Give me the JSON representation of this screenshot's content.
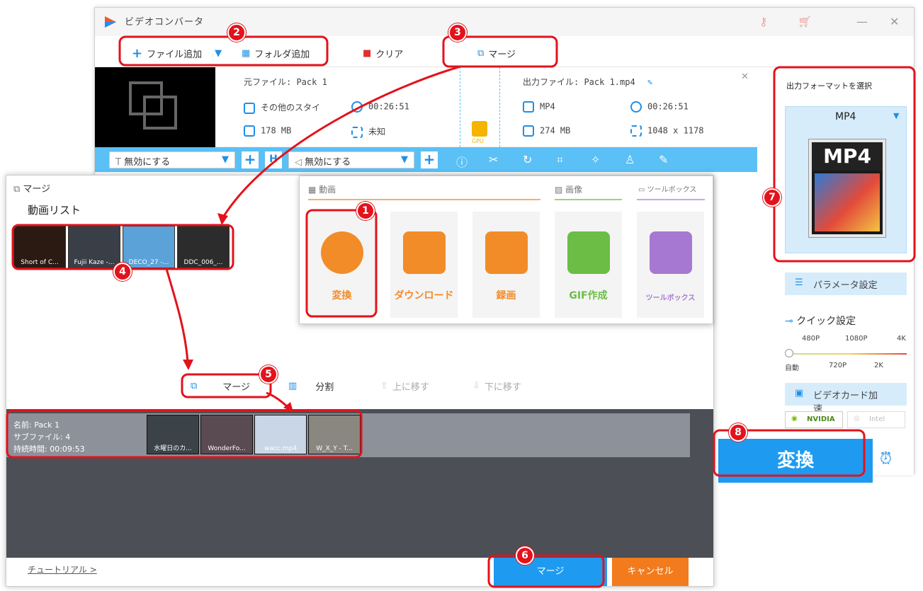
{
  "app": {
    "title": "ビデオコンバータ"
  },
  "toolbar": {
    "add_file": "ファイル追加",
    "add_folder": "フォルダ追加",
    "clear": "クリア",
    "merge": "マージ"
  },
  "file_item": {
    "source_label": "元ファイル: Pack 1",
    "source_format": "その他のスタイ",
    "source_duration": "00:26:51",
    "source_size": "178 MB",
    "source_resolution": "未知",
    "gpu": "GPU",
    "output_label": "出力ファイル: Pack 1.mp4",
    "output_format": "MP4",
    "output_duration": "00:26:51",
    "output_size": "274 MB",
    "output_resolution": "1048 x 1178"
  },
  "editbar": {
    "subtitle_select": "無効にする",
    "audio_select": "無効にする"
  },
  "right_panel": {
    "format_title": "出力フォーマットを選択",
    "format_value": "MP4",
    "format_icon_text": "MP4",
    "param_button": "パラメータ設定",
    "quick_title": "クイック設定",
    "quality_top": [
      "480P",
      "1080P",
      "4K"
    ],
    "quality_bottom": [
      "自動",
      "720P",
      "2K"
    ],
    "gpu_button": "ビデオカード加速",
    "nvidia": "NVIDIA",
    "intel": "Intel",
    "convert_button": "変換"
  },
  "merge_dialog": {
    "title": "マージ",
    "video_list_label": "動画リスト",
    "videos": [
      "Short of C...",
      "Fujii Kaze -...",
      "DECO_27 -...",
      "DDC_006_..."
    ],
    "merge_btn": "マージ",
    "split_btn": "分割",
    "move_up": "上に移す",
    "move_down": "下に移す",
    "pack_name": "名前: Pack 1",
    "pack_subfiles": "サブファイル: 4",
    "pack_duration": "持続時間: 00:09:53",
    "pack_videos": [
      "水曜日のカ...",
      "WonderFo...",
      "wacc.mp4",
      "W_X_Y - T..."
    ],
    "tutorial": "チュートリアル >",
    "merge_button": "マージ",
    "cancel_button": "キャンセル"
  },
  "popup": {
    "cat_video": "動画",
    "cat_image": "画像",
    "cat_toolbox": "ツールボックス",
    "tiles": [
      "変換",
      "ダウンロード",
      "録画",
      "GIF作成",
      "ツールボックス"
    ]
  },
  "badges": [
    "1",
    "2",
    "3",
    "4",
    "5",
    "6",
    "7",
    "8"
  ],
  "colors": {
    "accent": "#1e9bf0",
    "highlight": "#e3121b",
    "orange": "#f28c28",
    "green": "#6cbd45",
    "purple": "#a678d1"
  }
}
